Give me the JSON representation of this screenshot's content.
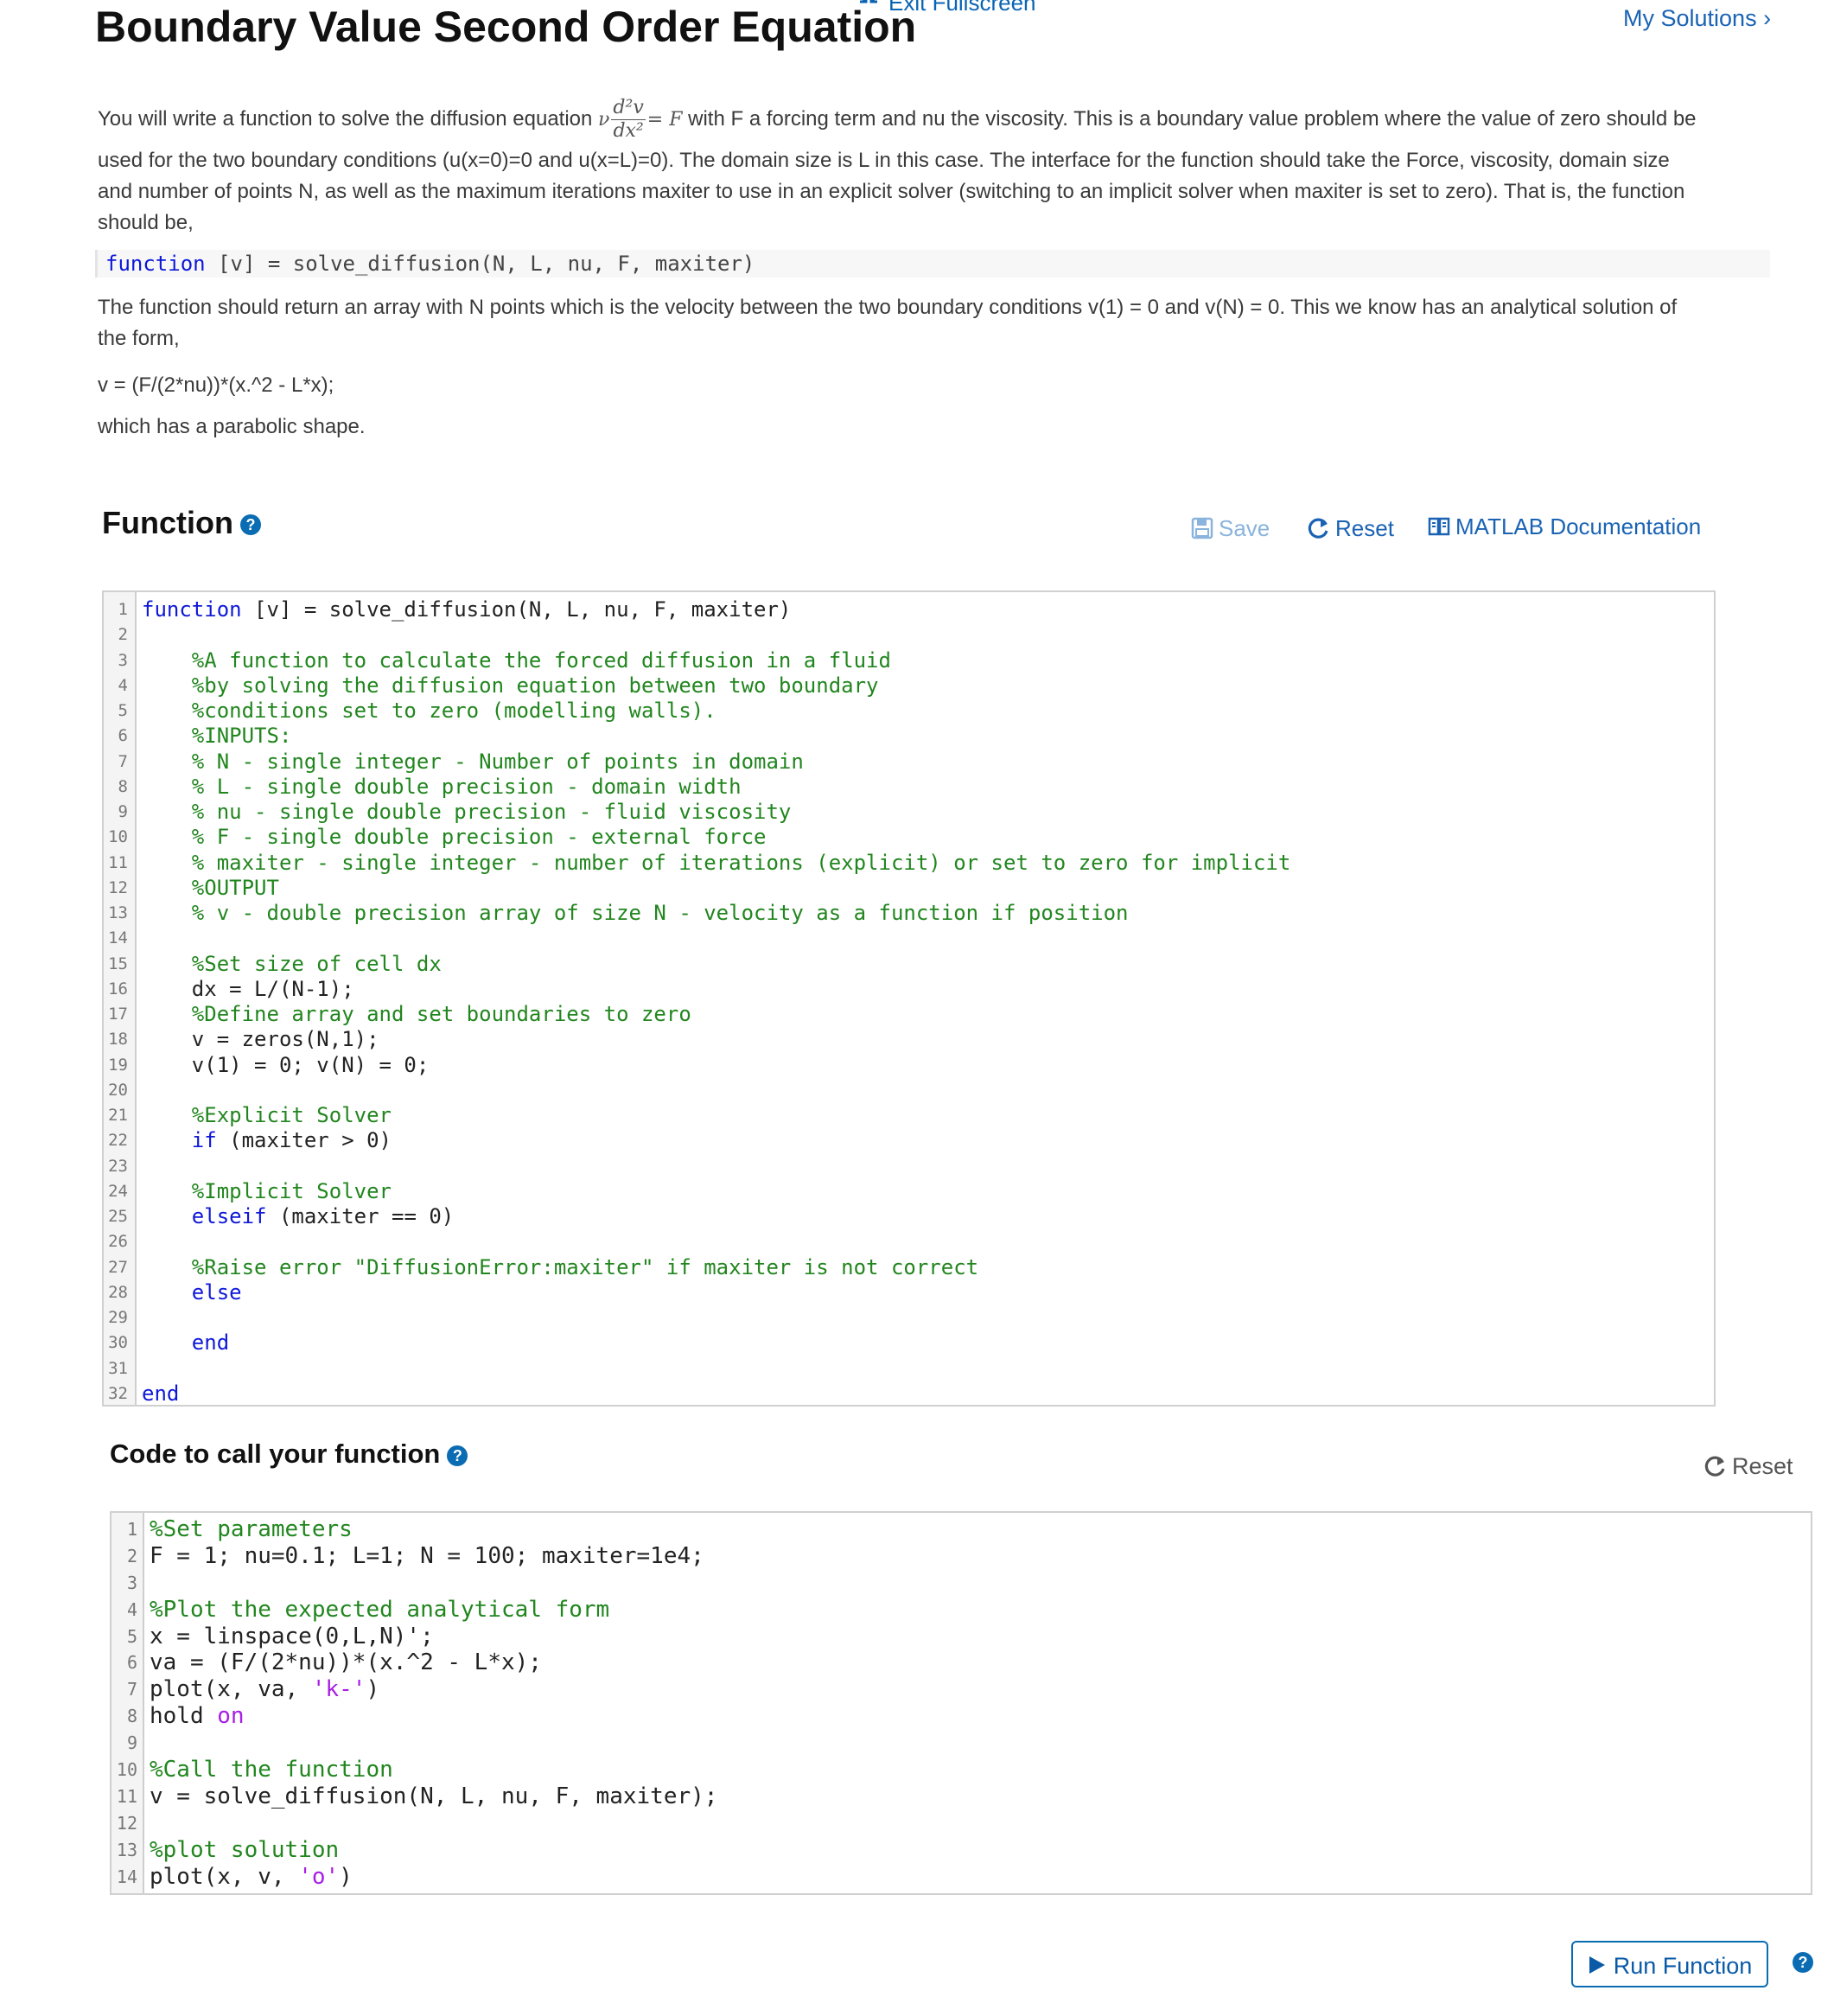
{
  "header": {
    "exit_fullscreen": "Exit Fullscreen",
    "title": "Boundary Value Second Order Equation",
    "my_solutions": "My Solutions ›"
  },
  "description": {
    "line1_pre": "You will write a function to solve the diffusion equation",
    "eq_nu": "ν",
    "eq_num": "d²v",
    "eq_den": "dx²",
    "eq_rhs": "= F",
    "line1_post": "with F a forcing term and nu the viscosity. This is a boundary value problem where the value of zero should be",
    "rest": "used for the two boundary conditions (u(x=0)=0 and u(x=L)=0). The domain size is L in this case. The interface for the function should take the Force, viscosity, domain size and number of points N, as well as the maximum iterations maxiter to use in an explicit solver (switching to an implicit solver when maxiter is set to zero). That is, the function should be,",
    "signature_keyword": "function",
    "signature_rest": " [v] = solve_diffusion(N, L, nu, F, maxiter)",
    "return_text": "The function should return an array with N points which is the velocity between the two boundary conditions v(1) = 0 and v(N) = 0. This we know has an analytical solution of the form,",
    "formula": "v = (F/(2*nu))*(x.^2 - L*x);",
    "parabolic": "which has a parabolic shape."
  },
  "function_section": {
    "heading": "Function",
    "help_icon": "?",
    "save_label": "Save",
    "reset_label": "Reset",
    "doc_label": "MATLAB Documentation"
  },
  "function_code": [
    {
      "n": "1",
      "t": "function [v] = solve_diffusion(N, L, nu, F, maxiter)",
      "type": "sig"
    },
    {
      "n": "2",
      "t": "",
      "type": "plain"
    },
    {
      "n": "3",
      "t": "    %A function to calculate the forced diffusion in a fluid",
      "type": "comment"
    },
    {
      "n": "4",
      "t": "    %by solving the diffusion equation between two boundary",
      "type": "comment"
    },
    {
      "n": "5",
      "t": "    %conditions set to zero (modelling walls).",
      "type": "comment"
    },
    {
      "n": "6",
      "t": "    %INPUTS:",
      "type": "comment"
    },
    {
      "n": "7",
      "t": "    % N - single integer - Number of points in domain",
      "type": "comment"
    },
    {
      "n": "8",
      "t": "    % L - single double precision - domain width",
      "type": "comment"
    },
    {
      "n": "9",
      "t": "    % nu - single double precision - fluid viscosity",
      "type": "comment"
    },
    {
      "n": "10",
      "t": "    % F - single double precision - external force",
      "type": "comment"
    },
    {
      "n": "11",
      "t": "    % maxiter - single integer - number of iterations (explicit) or set to zero for implicit",
      "type": "comment"
    },
    {
      "n": "12",
      "t": "    %OUTPUT",
      "type": "comment"
    },
    {
      "n": "13",
      "t": "    % v - double precision array of size N - velocity as a function if position",
      "type": "comment"
    },
    {
      "n": "14",
      "t": "",
      "type": "plain"
    },
    {
      "n": "15",
      "t": "    %Set size of cell dx",
      "type": "comment"
    },
    {
      "n": "16",
      "t": "    dx = L/(N-1);",
      "type": "plain"
    },
    {
      "n": "17",
      "t": "    %Define array and set boundaries to zero",
      "type": "comment"
    },
    {
      "n": "18",
      "t": "    v = zeros(N,1);",
      "type": "plain"
    },
    {
      "n": "19",
      "t": "    v(1) = 0; v(N) = 0;",
      "type": "plain"
    },
    {
      "n": "20",
      "t": "",
      "type": "plain"
    },
    {
      "n": "21",
      "t": "    %Explicit Solver",
      "type": "comment"
    },
    {
      "n": "22",
      "t": "    if (maxiter > 0)",
      "type": "kw"
    },
    {
      "n": "23",
      "t": "",
      "type": "plain"
    },
    {
      "n": "24",
      "t": "    %Implicit Solver",
      "type": "comment"
    },
    {
      "n": "25",
      "t": "    elseif (maxiter == 0)",
      "type": "kw"
    },
    {
      "n": "26",
      "t": "",
      "type": "plain"
    },
    {
      "n": "27",
      "t": "    %Raise error \"DiffusionError:maxiter\" if maxiter is not correct",
      "type": "comment"
    },
    {
      "n": "28",
      "t": "    else",
      "type": "kw"
    },
    {
      "n": "29",
      "t": "",
      "type": "plain"
    },
    {
      "n": "30",
      "t": "    end",
      "type": "kw"
    },
    {
      "n": "31",
      "t": "",
      "type": "plain"
    },
    {
      "n": "32",
      "t": "end",
      "type": "kw"
    }
  ],
  "call_section": {
    "heading": "Code to call your function",
    "help_icon": "?",
    "reset_label": "Reset"
  },
  "call_code": [
    {
      "n": "1",
      "t": "%Set parameters",
      "type": "comment"
    },
    {
      "n": "2",
      "t": "F = 1; nu=0.1; L=1; N = 100; maxiter=1e4;",
      "type": "plain"
    },
    {
      "n": "3",
      "t": "",
      "type": "plain"
    },
    {
      "n": "4",
      "t": "%Plot the expected analytical form",
      "type": "comment"
    },
    {
      "n": "5",
      "t": "x = linspace(0,L,N)';",
      "type": "plain"
    },
    {
      "n": "6",
      "t": "va = (F/(2*nu))*(x.^2 - L*x);",
      "type": "plain"
    },
    {
      "n": "7",
      "t": "plot(x, va, 'k-')",
      "type": "str"
    },
    {
      "n": "8",
      "t": "hold on",
      "type": "holdon"
    },
    {
      "n": "9",
      "t": "",
      "type": "plain"
    },
    {
      "n": "10",
      "t": "%Call the function",
      "type": "comment"
    },
    {
      "n": "11",
      "t": "v = solve_diffusion(N, L, nu, F, maxiter);",
      "type": "plain"
    },
    {
      "n": "12",
      "t": "",
      "type": "plain"
    },
    {
      "n": "13",
      "t": "%plot solution",
      "type": "comment"
    },
    {
      "n": "14",
      "t": "plot(x, v, 'o')",
      "type": "str"
    }
  ],
  "run": {
    "run_label": "Run Function",
    "help_icon": "?"
  },
  "colors": {
    "link": "#1a63b4",
    "comment": "#22861f",
    "keyword": "#0e18d8",
    "string": "#a81ee6"
  }
}
